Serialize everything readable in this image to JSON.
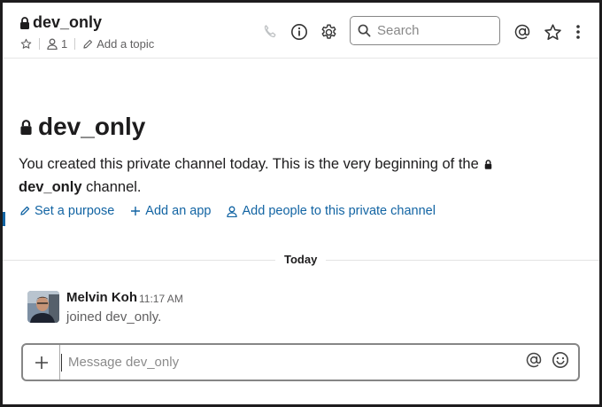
{
  "header": {
    "channel_name": "dev_only",
    "member_count": "1",
    "add_topic_label": "Add a topic",
    "search_placeholder": "Search"
  },
  "intro": {
    "title": "dev_only",
    "text_before": "You created this private channel today. This is the very beginning of the",
    "channel_name": "dev_only",
    "text_after": " channel.",
    "actions": [
      {
        "label": "Set a purpose",
        "icon": "pencil-icon"
      },
      {
        "label": "Add an app",
        "icon": "plus-icon"
      },
      {
        "label": "Add people to this private channel",
        "icon": "person-icon"
      }
    ]
  },
  "divider": {
    "label": "Today"
  },
  "message": {
    "author": "Melvin Koh",
    "time": "11:17 AM",
    "body": "joined dev_only."
  },
  "composer": {
    "placeholder": "Message dev_only"
  },
  "colors": {
    "link": "#1264a3",
    "text": "#1d1c1d",
    "muted": "#616061",
    "frame": "#1d1c1d"
  }
}
